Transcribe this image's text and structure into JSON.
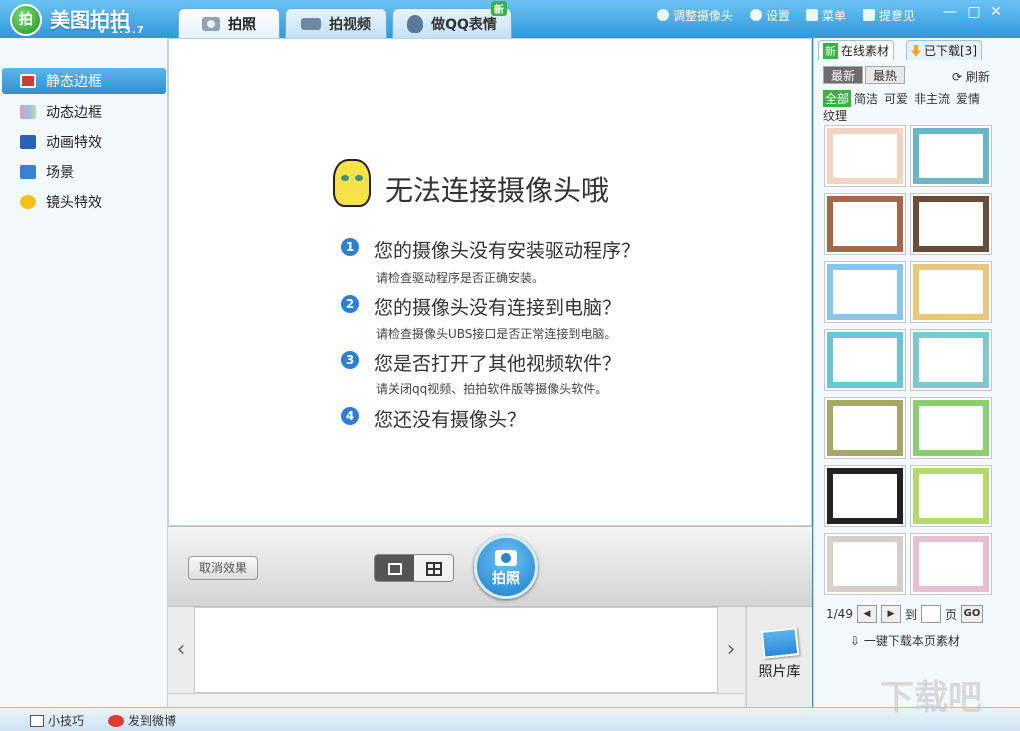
{
  "app": {
    "title": "美图拍拍",
    "version": "V 1.3.7",
    "logo_text": "拍"
  },
  "tabs": [
    {
      "label": "拍照",
      "icon": "camera-icon",
      "active": true
    },
    {
      "label": "拍视频",
      "icon": "video-icon",
      "active": false
    },
    {
      "label": "做QQ表情",
      "icon": "qq-penguin-icon",
      "active": false,
      "badge": "新"
    }
  ],
  "top_menu": [
    {
      "label": "调整摄像头",
      "icon": "webcam-icon"
    },
    {
      "label": "设置",
      "icon": "gear-icon"
    },
    {
      "label": "菜单",
      "icon": "menu-icon"
    },
    {
      "label": "提意见",
      "icon": "feedback-icon"
    }
  ],
  "window_controls": {
    "minimize": "—",
    "maximize": "□",
    "close": "✕"
  },
  "sidebar": {
    "items": [
      {
        "label": "静态边框",
        "icon": "static-frame-icon",
        "color": "#d23a3a",
        "active": true
      },
      {
        "label": "动态边框",
        "icon": "dynamic-frame-icon",
        "color": "#7a6fd1",
        "active": false
      },
      {
        "label": "动画特效",
        "icon": "animation-effect-icon",
        "color": "#2a63b5",
        "active": false
      },
      {
        "label": "场景",
        "icon": "scene-icon",
        "color": "#3d7fd6",
        "active": false
      },
      {
        "label": "镜头特效",
        "icon": "lens-effect-icon",
        "color": "#f2c316",
        "active": false
      }
    ]
  },
  "preview": {
    "headline": "无法连接摄像头哦",
    "questions": [
      {
        "num": "1",
        "title": "您的摄像头没有安装驱动程序？",
        "sub": "请检查驱动程序是否正确安装。"
      },
      {
        "num": "2",
        "title": "您的摄像头没有连接到电脑？",
        "sub": "请检查摄像头UBS接口是否正常连接到电脑。"
      },
      {
        "num": "3",
        "title": "您是否打开了其他视频软件？",
        "sub": "请关闭qq视频、拍拍软件版等摄像头软件。"
      },
      {
        "num": "4",
        "title": "您还没有摄像头？",
        "sub": ""
      }
    ]
  },
  "controls": {
    "cancel_effect": "取消效果",
    "shoot": "拍照"
  },
  "filmstrip": {
    "prev": "‹",
    "next": "›",
    "photo_library": "照片库"
  },
  "right_panel": {
    "tabs": [
      {
        "label": "在线素材",
        "badge": "新",
        "active": true
      },
      {
        "label": "已下载[3]",
        "active": false
      }
    ],
    "subtabs": [
      {
        "label": "最新",
        "active": true
      },
      {
        "label": "最热",
        "active": false
      }
    ],
    "refresh": "刷新",
    "categories": [
      {
        "label": "全部",
        "active": true
      },
      {
        "label": "简洁",
        "active": false
      },
      {
        "label": "可爱",
        "active": false
      },
      {
        "label": "非主流",
        "active": false
      },
      {
        "label": "爱情",
        "active": false
      },
      {
        "label": "纹理",
        "active": false
      }
    ],
    "thumbnail_colors": [
      "#f2d3c2",
      "#6bb6c6",
      "#a5674a",
      "#6b4c3a",
      "#8ac6e8",
      "#e8c87a",
      "#6cc4d8",
      "#7ec8d0",
      "#a8a76a",
      "#8ccf72",
      "#222222",
      "#b3d96a",
      "#d8d0c8",
      "#e8bfd0"
    ],
    "pager": {
      "current": "1/49",
      "goto": "到",
      "page": "页",
      "go": "GO"
    },
    "download_all": "一键下载本页素材"
  },
  "statusbar": {
    "tips": "小技巧",
    "weibo": "发到微博"
  },
  "watermark": "下载吧"
}
